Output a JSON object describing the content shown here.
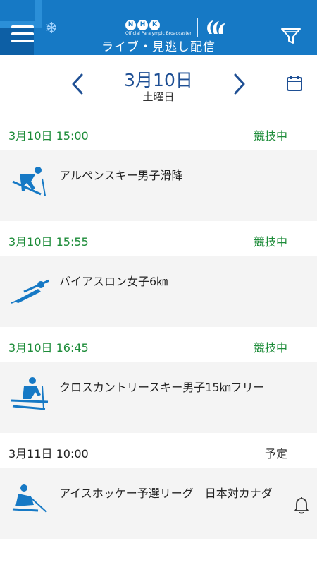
{
  "header": {
    "title": "ライブ・見逃し配信",
    "logo_letters": [
      "N",
      "H",
      "K"
    ],
    "logo_sub": "Official Paralympic Broadcaster",
    "menu_icon": "hamburger-menu-icon",
    "filter_icon": "filter-icon",
    "brand_color": "#1679c5"
  },
  "datebar": {
    "date": "3月10日",
    "weekday": "土曜日",
    "prev_icon": "chevron-left-icon",
    "next_icon": "chevron-right-icon",
    "calendar_icon": "calendar-icon"
  },
  "events": [
    {
      "time": "3月10日 15:00",
      "status": "競技中",
      "title": "アルペンスキー男子滑降",
      "icon": "alpine-ski-icon"
    },
    {
      "time": "3月10日 15:55",
      "status": "競技中",
      "title": "バイアスロン女子6㎞",
      "icon": "biathlon-icon"
    },
    {
      "time": "3月10日 16:45",
      "status": "競技中",
      "title": "クロスカントリースキー男子15㎞フリー",
      "icon": "cross-country-ski-icon"
    },
    {
      "time": "3月11日 10:00",
      "status": "予定",
      "title": "アイスホッケー予選リーグ　日本対カナダ",
      "icon": "ice-hockey-icon",
      "action_icon": "bell-icon"
    }
  ],
  "colors": {
    "live": "#1d8c39",
    "accent": "#1e4f94"
  }
}
